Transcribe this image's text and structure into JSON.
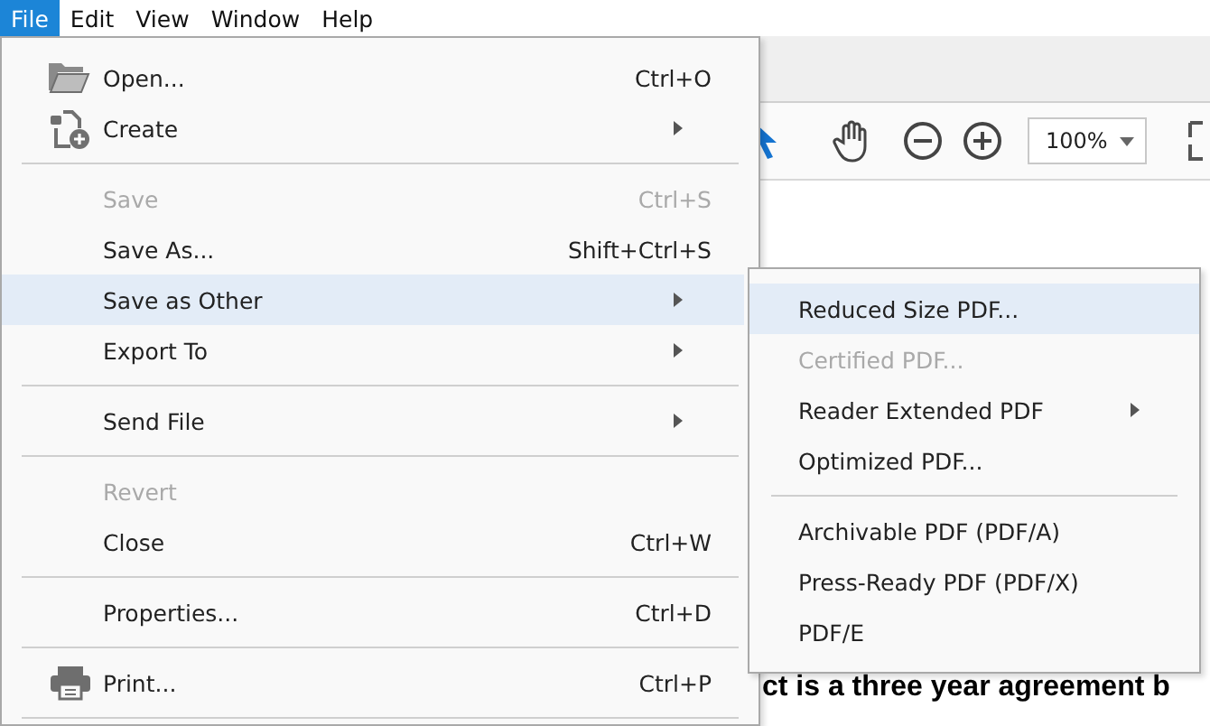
{
  "menubar": [
    {
      "label": "File",
      "selected": true
    },
    {
      "label": "Edit",
      "selected": false
    },
    {
      "label": "View",
      "selected": false
    },
    {
      "label": "Window",
      "selected": false
    },
    {
      "label": "Help",
      "selected": false
    }
  ],
  "toolbar": {
    "zoom": "100%"
  },
  "document": {
    "line": "ct is a three year agreement b"
  },
  "file_menu": [
    {
      "kind": "item",
      "label": "Open...",
      "shortcut": "Ctrl+O",
      "disabled": false,
      "selected": false
    },
    {
      "kind": "item",
      "label": "Create",
      "submenu": true,
      "disabled": false,
      "selected": false
    },
    {
      "kind": "separator"
    },
    {
      "kind": "item",
      "label": "Save",
      "shortcut": "Ctrl+S",
      "disabled": true,
      "selected": false
    },
    {
      "kind": "item",
      "label": "Save As...",
      "shortcut": "Shift+Ctrl+S",
      "disabled": false,
      "selected": false
    },
    {
      "kind": "item",
      "label": "Save as Other",
      "submenu": true,
      "disabled": false,
      "selected": true
    },
    {
      "kind": "item",
      "label": "Export To",
      "submenu": true,
      "disabled": false,
      "selected": false
    },
    {
      "kind": "separator"
    },
    {
      "kind": "item",
      "label": "Send File",
      "submenu": true,
      "disabled": false,
      "selected": false
    },
    {
      "kind": "separator"
    },
    {
      "kind": "item",
      "label": "Revert",
      "disabled": true,
      "selected": false
    },
    {
      "kind": "item",
      "label": "Close",
      "shortcut": "Ctrl+W",
      "disabled": false,
      "selected": false
    },
    {
      "kind": "separator"
    },
    {
      "kind": "item",
      "label": "Properties...",
      "shortcut": "Ctrl+D",
      "disabled": false,
      "selected": false
    },
    {
      "kind": "separator"
    },
    {
      "kind": "item",
      "label": "Print...",
      "shortcut": "Ctrl+P",
      "disabled": false,
      "selected": false
    },
    {
      "kind": "separator"
    }
  ],
  "save_as_other_menu": [
    {
      "kind": "item",
      "label": "Reduced Size PDF...",
      "disabled": false,
      "selected": true
    },
    {
      "kind": "item",
      "label": "Certified PDF...",
      "disabled": true,
      "selected": false
    },
    {
      "kind": "item",
      "label": "Reader Extended PDF",
      "submenu": true,
      "disabled": false,
      "selected": false
    },
    {
      "kind": "item",
      "label": "Optimized PDF...",
      "disabled": false,
      "selected": false
    },
    {
      "kind": "separator"
    },
    {
      "kind": "item",
      "label": "Archivable PDF (PDF/A)",
      "disabled": false,
      "selected": false
    },
    {
      "kind": "item",
      "label": "Press-Ready PDF (PDF/X)",
      "disabled": false,
      "selected": false
    },
    {
      "kind": "item",
      "label": "PDF/E",
      "disabled": false,
      "selected": false
    }
  ]
}
